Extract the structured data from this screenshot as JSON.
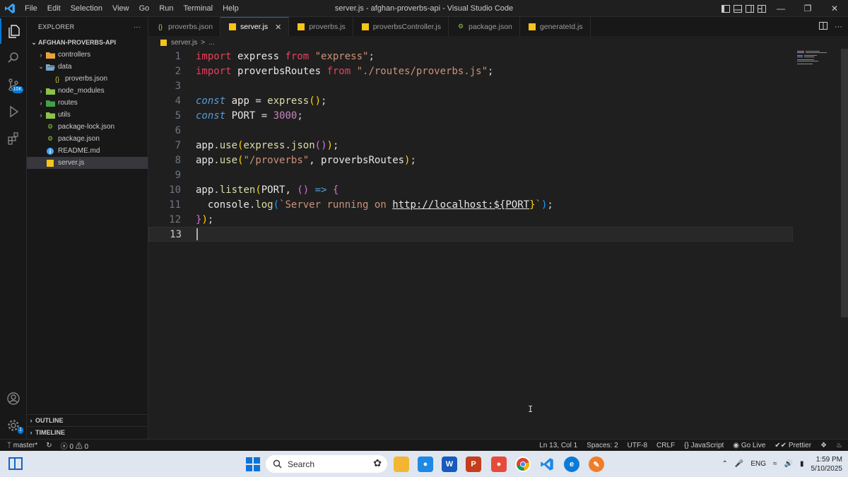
{
  "window": {
    "title": "server.js - afghan-proverbs-api - Visual Studio Code",
    "menu": [
      "File",
      "Edit",
      "Selection",
      "View",
      "Go",
      "Run",
      "Terminal",
      "Help"
    ]
  },
  "activity": {
    "source_control_badge": "10K"
  },
  "sidebar": {
    "header": "EXPLORER",
    "more": "···",
    "project": "AFGHAN-PROVERBS-API",
    "items": [
      {
        "label": "controllers"
      },
      {
        "label": "data"
      },
      {
        "label": "proverbs.json"
      },
      {
        "label": "node_modules"
      },
      {
        "label": "routes"
      },
      {
        "label": "utils"
      },
      {
        "label": "package-lock.json"
      },
      {
        "label": "package.json"
      },
      {
        "label": "README.md"
      },
      {
        "label": "server.js"
      }
    ],
    "outline": "OUTLINE",
    "timeline": "TIMELINE"
  },
  "tabs": [
    {
      "label": "proverbs.json"
    },
    {
      "label": "server.js",
      "close": "✕"
    },
    {
      "label": "proverbs.js"
    },
    {
      "label": "proverbsController.js"
    },
    {
      "label": "package.json"
    },
    {
      "label": "generateId.js"
    }
  ],
  "breadcrumb": {
    "file": "server.js",
    "sep": ">",
    "rest": "..."
  },
  "editor": {
    "line_numbers": [
      "1",
      "2",
      "3",
      "4",
      "5",
      "6",
      "7",
      "8",
      "9",
      "10",
      "11",
      "12",
      "13"
    ],
    "l1": {
      "a": "import",
      "b": " express ",
      "c": "from",
      "d": " \"express\"",
      "e": ";"
    },
    "l2": {
      "a": "import",
      "b": " proverbsRoutes ",
      "c": "from",
      "d": " \"./routes/proverbs.js\"",
      "e": ";"
    },
    "l4": {
      "a": "const",
      "b": " app ",
      "c": "=",
      "d": " express",
      "e": "()",
      "f": ";"
    },
    "l5": {
      "a": "const",
      "b": " PORT ",
      "c": "=",
      "d": " 3000",
      "e": ";"
    },
    "l7": {
      "a": "app",
      "b": ".",
      "c": "use",
      "d": "(",
      "e": "express",
      "f": ".",
      "g": "json",
      "h": "()",
      "i": ")",
      "j": ";"
    },
    "l8": {
      "a": "app",
      "b": ".",
      "c": "use",
      "d": "(",
      "e": "\"/proverbs\"",
      "f": ", proverbsRoutes",
      "g": ")",
      "h": ";"
    },
    "l10": {
      "a": "app",
      "b": ".",
      "c": "listen",
      "d": "(",
      "e": "PORT, ",
      "f": "()",
      "g": " => ",
      "h": "{"
    },
    "l11": {
      "a": "  console",
      "b": ".",
      "c": "log",
      "d": "(",
      "e": "`Server running on ",
      "f": "http://localhost:",
      "g": "${",
      "h": "PORT",
      "i": "}",
      "j": "`",
      "k": ")",
      "l": ";"
    },
    "l12": {
      "a": "}",
      "b": ")",
      "c": ";"
    }
  },
  "status": {
    "branch": "master*",
    "sync": "↻",
    "errors": "ⓧ 0",
    "warnings": "⚠ 0",
    "position": "Ln 13, Col 1",
    "spaces": "Spaces: 2",
    "encoding": "UTF-8",
    "eol": "CRLF",
    "language": "{} JavaScript",
    "golive": "Go Live",
    "prettier": "✔✔ Prettier"
  },
  "taskbar": {
    "search_placeholder": "Search",
    "lang": "ENG",
    "time": "1:59 PM",
    "date": "5/10/2025"
  },
  "colors": {
    "accent": "#0078d4",
    "editor_bg": "#1f1f1f",
    "keyword_import": "#e8405a",
    "string": "#ce9178"
  }
}
